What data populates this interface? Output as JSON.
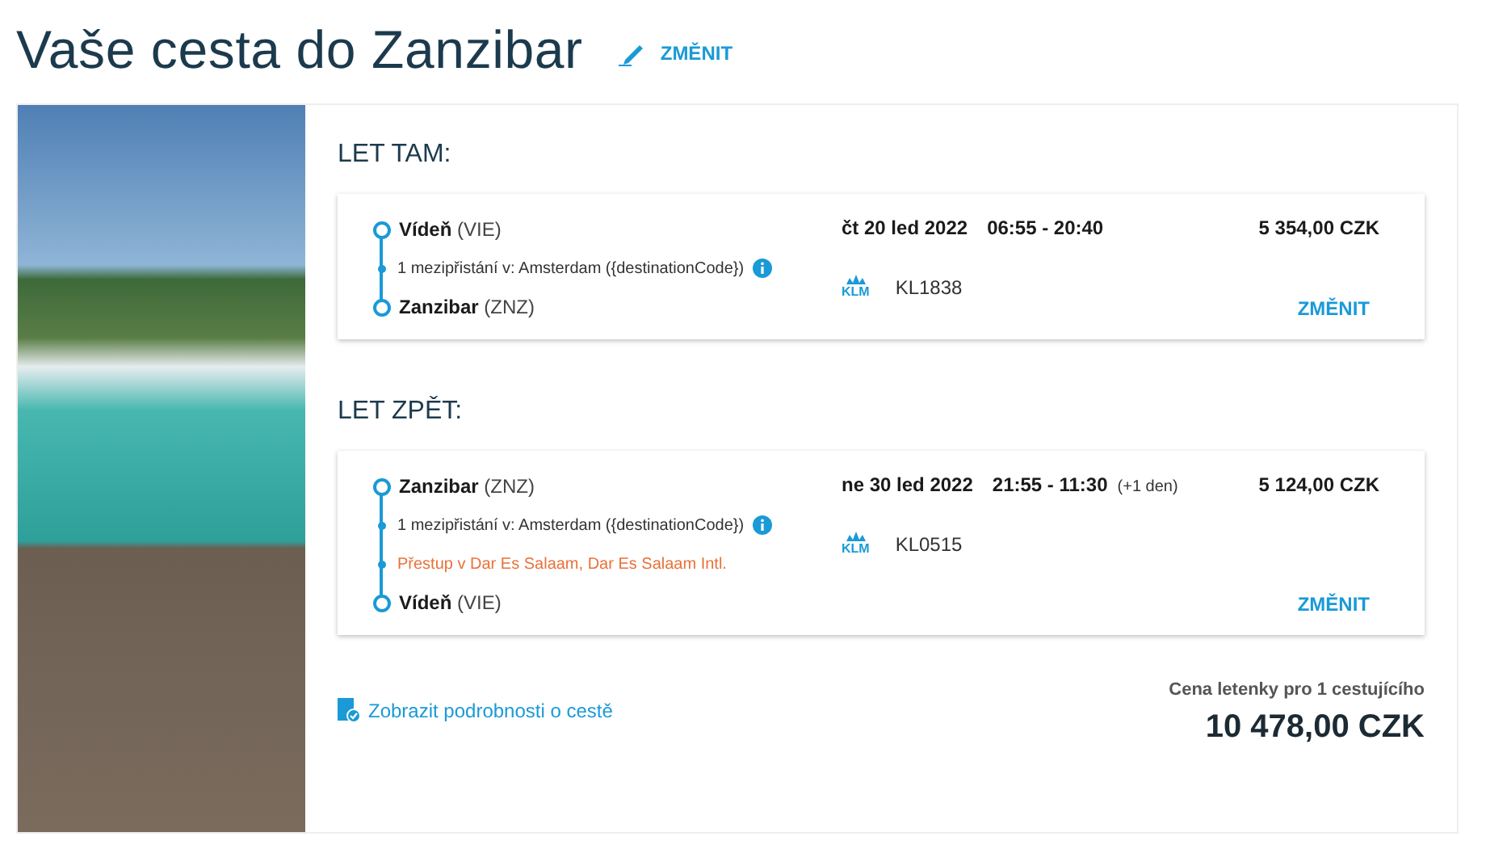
{
  "header": {
    "title": "Vaše cesta do Zanzibar",
    "edit_link": "ZMĚNIT"
  },
  "flights": [
    {
      "heading": "LET TAM:",
      "stops": [
        {
          "kind": "endpoint",
          "city": "Vídeň",
          "code": "(VIE)"
        },
        {
          "kind": "stopover",
          "text": "1 mezipřistání v: Amsterdam ({destinationCode})"
        },
        {
          "kind": "endpoint",
          "city": "Zanzibar",
          "code": "(ZNZ)"
        }
      ],
      "date": "čt 20 led 2022",
      "times": "06:55 - 20:40",
      "price": "5 354,00 CZK",
      "airline": "KLM",
      "flight_number": "KL1838",
      "change": "ZMĚNIT"
    },
    {
      "heading": "LET ZPĚT:",
      "stops": [
        {
          "kind": "endpoint",
          "city": "Zanzibar",
          "code": "(ZNZ)"
        },
        {
          "kind": "stopover",
          "text": "1 mezipřistání v: Amsterdam ({destinationCode})"
        },
        {
          "kind": "transfer",
          "text": "Přestup v Dar Es Salaam, Dar Es Salaam Intl."
        },
        {
          "kind": "endpoint",
          "city": "Vídeň",
          "code": "(VIE)"
        }
      ],
      "date": "ne 30 led 2022",
      "times": "21:55 - 11:30",
      "next_day": "(+1 den)",
      "price": "5 124,00 CZK",
      "airline": "KLM",
      "flight_number": "KL0515",
      "change": "ZMĚNIT"
    }
  ],
  "footer": {
    "details_link": "Zobrazit podrobnosti o cestě",
    "price_label": "Cena letenky pro 1 cestujícího",
    "total": "10 478,00 CZK"
  }
}
